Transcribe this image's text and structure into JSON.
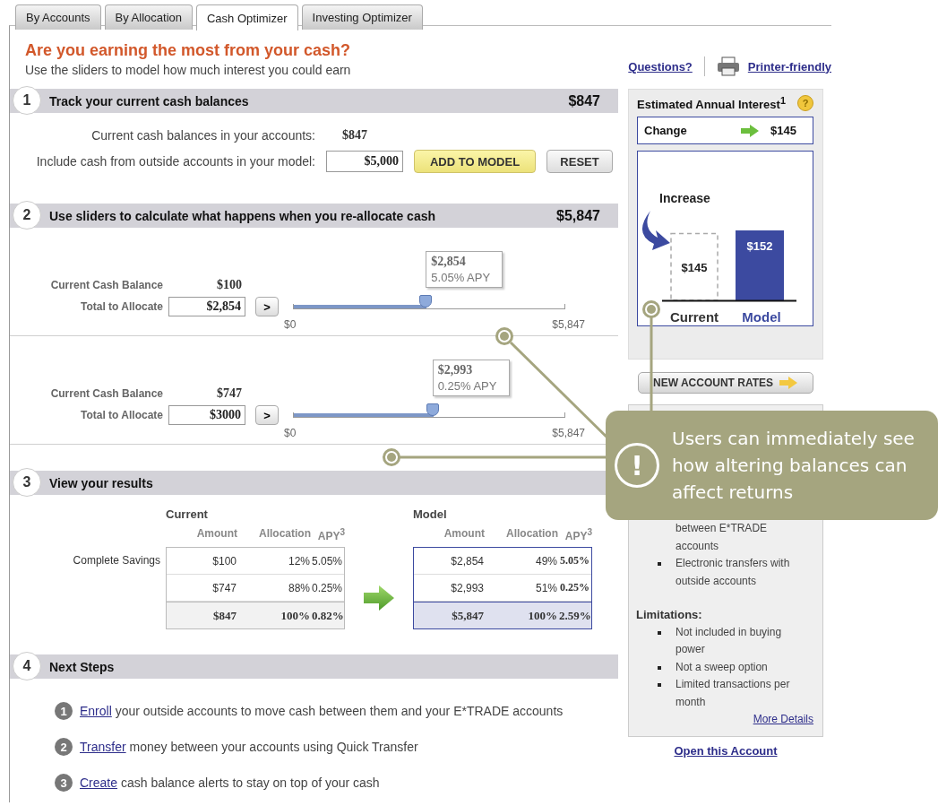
{
  "tabs": [
    {
      "label": "By Accounts",
      "selected": false
    },
    {
      "label": "By Allocation",
      "selected": false
    },
    {
      "label": "Cash Optimizer",
      "selected": true
    },
    {
      "label": "Investing Optimizer",
      "selected": false
    }
  ],
  "header": {
    "title": "Are you earning the most from your cash?",
    "subtitle": "Use the sliders to model how much interest you could earn",
    "questions_link": "Questions?",
    "printer_link": "Printer-friendly"
  },
  "step1": {
    "number": "1",
    "title": "Track your current cash balances",
    "total": "$847",
    "balance_label": "Current cash balances in your accounts:",
    "balance_value": "$847",
    "outside_label": "Include cash from outside accounts in your model:",
    "outside_value": "$5,000",
    "add_button": "ADD TO MODEL",
    "reset_button": "RESET"
  },
  "step2": {
    "number": "2",
    "title": "Use sliders to calculate what happens when you re-allocate cash",
    "total": "$5,847",
    "sliders": [
      {
        "balance_label": "Current Cash Balance",
        "balance": "$100",
        "allocate_label": "Total to Allocate",
        "allocate_value": "$2,854",
        "go_button": ">",
        "level": 0.488,
        "tip_amount": "$2,854",
        "tip_apy": "5.05% APY",
        "min": "$0",
        "max": "$5,847"
      },
      {
        "balance_label": "Current Cash Balance",
        "balance": "$747",
        "allocate_label": "Total to Allocate",
        "allocate_value": "$3000",
        "go_button": ">",
        "level": 0.512,
        "tip_amount": "$2,993",
        "tip_apy": "0.25% APY",
        "min": "$0",
        "max": "$5,847"
      }
    ]
  },
  "step3": {
    "number": "3",
    "title": "View your results",
    "row_label": "Complete Savings",
    "tables": [
      {
        "kind": "current",
        "title": "Current",
        "columns": [
          "Amount",
          "Allocation",
          "APY$^{3}$"
        ],
        "rows": [
          [
            "$100",
            "12%",
            "5.05%"
          ],
          [
            "$747",
            "88%",
            "0.25%"
          ]
        ],
        "total": [
          "$847",
          "100%",
          "0.82%"
        ]
      },
      {
        "kind": "model",
        "title": "Model",
        "columns": [
          "Amount",
          "Allocation",
          "APY$^{3}$"
        ],
        "rows": [
          [
            "$2,854",
            "49%",
            "5.05%"
          ],
          [
            "$2,993",
            "51%",
            "0.25%"
          ]
        ],
        "total": [
          "$5,847",
          "100%",
          "2.59%"
        ]
      }
    ]
  },
  "step4": {
    "number": "4",
    "title": "Next Steps",
    "steps": [
      {
        "number": "1",
        "link": "Enroll",
        "text": "your outside accounts to move cash between them and your E*TRADE accounts"
      },
      {
        "number": "2",
        "link": "Transfer",
        "text": "money between your accounts using Quick Transfer"
      },
      {
        "number": "3",
        "link": "Create",
        "text": "cash balance alerts to stay on top of your cash"
      }
    ]
  },
  "interest_panel": {
    "title": "Estimated Annual Interest$^{1}$",
    "help": "?",
    "change_label": "Change",
    "change_value": "$145",
    "increase_label": "Increase",
    "chart_data": {
      "type": "bar",
      "categories": [
        "Current",
        "Model"
      ],
      "values": [
        145,
        152
      ],
      "value_labels": [
        "$145",
        "$152"
      ]
    },
    "rates_button": "NEW ACCOUNT RATES"
  },
  "features_panel": {
    "features": [
      {
        "text": "between E*TRADE accounts",
        "bullet": false
      },
      {
        "text": "Electronic transfers with outside accounts",
        "bullet": true
      }
    ],
    "limitations_title": "Limitations:",
    "limitations": [
      "Not included in buying power",
      "Not a sweep option",
      "Limited transactions per month"
    ],
    "more_link": "More Details"
  },
  "open_link": "Open this Account",
  "callout": {
    "icon": "!",
    "text": "Users can immediately see how altering balances can affect returns"
  }
}
